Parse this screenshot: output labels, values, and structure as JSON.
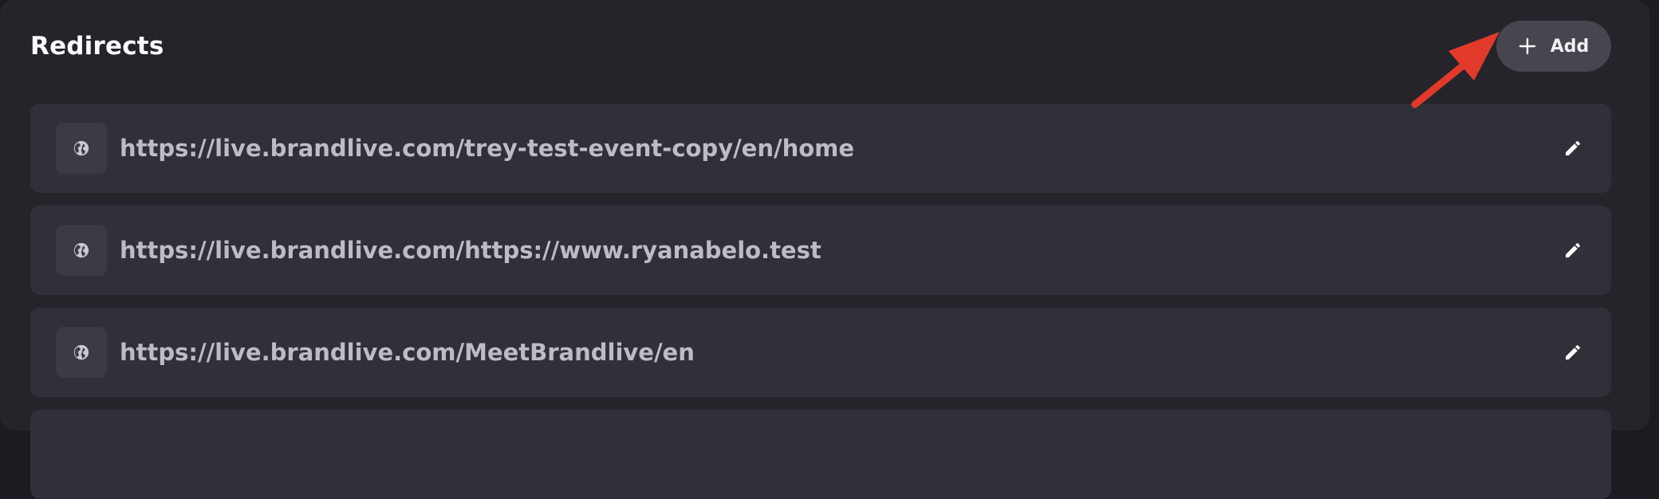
{
  "section": {
    "title": "Redirects"
  },
  "toolbar": {
    "add_label": "Add"
  },
  "redirects": [
    {
      "url": "https://live.brandlive.com/trey-test-event-copy/en/home",
      "icon": "globe-icon"
    },
    {
      "url": "https://live.brandlive.com/https://www.ryanabelo.test",
      "icon": "globe-icon"
    },
    {
      "url": "https://live.brandlive.com/MeetBrandlive/en",
      "icon": "globe-icon"
    }
  ],
  "colors": {
    "background": "#1c1b21",
    "panel": "#25242b",
    "row": "#303039",
    "button": "#47464f",
    "url_text": "#bdbcc4",
    "annotation_arrow": "#e23a2a"
  }
}
